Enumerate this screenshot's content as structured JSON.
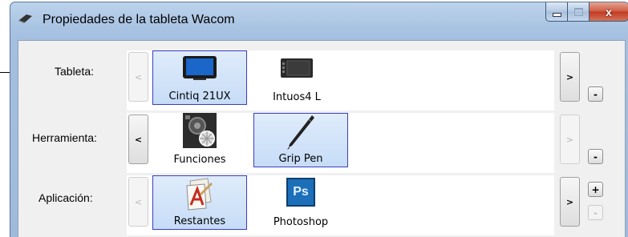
{
  "window": {
    "title": "Propiedades de la tableta Wacom",
    "controls": {
      "minimize": "minimize-icon",
      "maximize": "maximize-icon",
      "close_label": "x"
    }
  },
  "rows": {
    "tablet": {
      "label": "Tableta:",
      "prev": "<",
      "next": ">",
      "remove": "-",
      "items": [
        {
          "label": "Cintiq 21UX",
          "icon": "cintiq-display-icon",
          "selected": true
        },
        {
          "label": "Intuos4 L",
          "icon": "intuos-tablet-icon",
          "selected": false
        }
      ]
    },
    "tool": {
      "label": "Herramienta:",
      "prev": "<",
      "next": ">",
      "remove": "-",
      "items": [
        {
          "label": "Funciones",
          "icon": "functions-icon",
          "selected": false
        },
        {
          "label": "Grip Pen",
          "icon": "grip-pen-icon",
          "selected": true
        }
      ]
    },
    "application": {
      "label": "Aplicación:",
      "prev": "<",
      "next": ">",
      "add": "+",
      "remove": "-",
      "items": [
        {
          "label": "Restantes",
          "icon": "all-other-apps-icon",
          "selected": true
        },
        {
          "label": "Photoshop",
          "icon": "photoshop-icon",
          "selected": false,
          "icon_text": "Ps"
        }
      ]
    }
  },
  "colors": {
    "selection_border": "#3d3dbf",
    "selection_fill": "#c6dcf7",
    "close_red": "#c03a20",
    "photoshop_blue": "#1c6fb8"
  }
}
